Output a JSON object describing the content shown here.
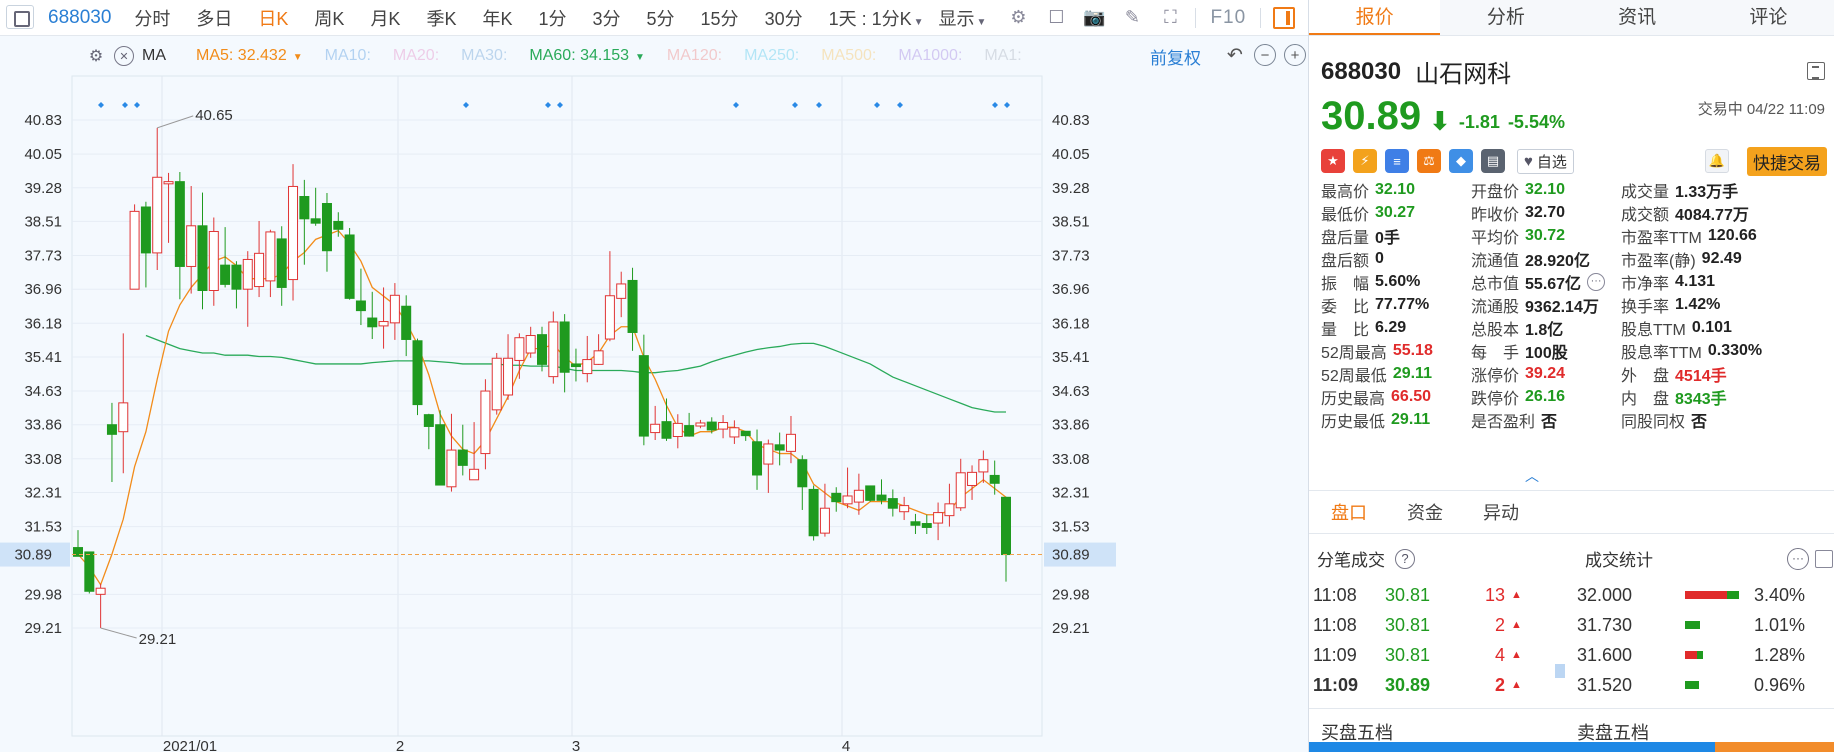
{
  "toolbar": {
    "symbol": "688030",
    "periods": [
      "分时",
      "多日",
      "日K",
      "周K",
      "月K",
      "季K",
      "年K",
      "1分",
      "3分",
      "5分",
      "15分",
      "30分"
    ],
    "active_period": "日K",
    "range_label": "1天 : 1分K",
    "display_label": "显示",
    "f10": "F10"
  },
  "chart": {
    "ma_selector": "MA",
    "ma": [
      {
        "label": "MA5: 32.432",
        "color": "#f28c1a",
        "active": true,
        "has_caret": true
      },
      {
        "label": "MA10:",
        "color": "#7fb4e8",
        "active": false
      },
      {
        "label": "MA20:",
        "color": "#e9a9d6",
        "active": false
      },
      {
        "label": "MA30:",
        "color": "#8fb8e0",
        "active": false
      },
      {
        "label": "MA60: 34.153",
        "color": "#2aaa5a",
        "active": true,
        "has_caret": true
      },
      {
        "label": "MA120:",
        "color": "#f0a3a3",
        "active": false
      },
      {
        "label": "MA250:",
        "color": "#7fd6f0",
        "active": false
      },
      {
        "label": "MA500:",
        "color": "#f6d28a",
        "active": false
      },
      {
        "label": "MA1000:",
        "color": "#b9a3ea",
        "active": false
      },
      {
        "label": "MA1:",
        "color": "#bfc6d0",
        "active": false
      }
    ],
    "adjust_label": "前复权",
    "price_ticks": [
      "40.83",
      "40.05",
      "39.28",
      "38.51",
      "37.73",
      "36.96",
      "36.18",
      "35.41",
      "34.63",
      "33.86",
      "33.08",
      "32.31",
      "31.53",
      "30.89",
      "29.98",
      "29.21"
    ],
    "current_price_label": "30.89",
    "x_labels": [
      "2021/01",
      "2",
      "3",
      "4"
    ],
    "max_annotation": "40.65",
    "min_annotation": "29.21"
  },
  "chart_data": {
    "type": "candlestick",
    "y_range": [
      28.6,
      41.3
    ],
    "current_price": 30.89,
    "candles": [
      {
        "o": 31.05,
        "c": 30.85,
        "h": 31.45,
        "l": 30.85
      },
      {
        "o": 30.95,
        "c": 30.05,
        "h": 30.95,
        "l": 30.0
      },
      {
        "o": 29.98,
        "c": 30.12,
        "h": 30.22,
        "l": 29.21
      },
      {
        "o": 33.86,
        "c": 33.64,
        "h": 34.36,
        "l": 32.55
      },
      {
        "o": 33.7,
        "c": 34.36,
        "h": 35.95,
        "l": 32.75
      },
      {
        "o": 36.96,
        "c": 38.74,
        "h": 38.9,
        "l": 36.96
      },
      {
        "o": 38.84,
        "c": 37.79,
        "h": 38.96,
        "l": 37.0
      },
      {
        "o": 37.79,
        "c": 39.52,
        "h": 40.65,
        "l": 37.4
      },
      {
        "o": 39.37,
        "c": 39.42,
        "h": 39.62,
        "l": 38.02
      },
      {
        "o": 39.42,
        "c": 37.48,
        "h": 39.64,
        "l": 36.73
      },
      {
        "o": 37.48,
        "c": 38.41,
        "h": 39.32,
        "l": 36.86
      },
      {
        "o": 38.41,
        "c": 36.93,
        "h": 39.17,
        "l": 36.5
      },
      {
        "o": 36.93,
        "c": 38.28,
        "h": 38.6,
        "l": 36.58
      },
      {
        "o": 37.51,
        "c": 37.07,
        "h": 38.38,
        "l": 37.0
      },
      {
        "o": 37.51,
        "c": 36.96,
        "h": 37.6,
        "l": 36.52
      },
      {
        "o": 36.96,
        "c": 37.64,
        "h": 37.83,
        "l": 36.1
      },
      {
        "o": 37.02,
        "c": 37.78,
        "h": 38.52,
        "l": 36.78
      },
      {
        "o": 37.15,
        "c": 38.27,
        "h": 38.32,
        "l": 36.78
      },
      {
        "o": 38.11,
        "c": 37.0,
        "h": 38.4,
        "l": 36.58
      },
      {
        "o": 37.18,
        "c": 39.31,
        "h": 39.82,
        "l": 36.7
      },
      {
        "o": 39.08,
        "c": 38.57,
        "h": 39.46,
        "l": 37.52
      },
      {
        "o": 38.57,
        "c": 38.47,
        "h": 39.28,
        "l": 38.41
      },
      {
        "o": 38.92,
        "c": 37.84,
        "h": 39.16,
        "l": 37.36
      },
      {
        "o": 38.51,
        "c": 38.33,
        "h": 38.72,
        "l": 38.16
      },
      {
        "o": 38.2,
        "c": 36.75,
        "h": 38.36,
        "l": 36.72
      },
      {
        "o": 36.69,
        "c": 36.47,
        "h": 37.43,
        "l": 36.14
      },
      {
        "o": 36.3,
        "c": 36.1,
        "h": 36.9,
        "l": 35.82
      },
      {
        "o": 36.12,
        "c": 36.22,
        "h": 37.0,
        "l": 35.6
      },
      {
        "o": 36.19,
        "c": 36.82,
        "h": 37.1,
        "l": 35.8
      },
      {
        "o": 36.57,
        "c": 35.81,
        "h": 36.82,
        "l": 35.43
      },
      {
        "o": 35.78,
        "c": 34.32,
        "h": 35.83,
        "l": 34.08
      },
      {
        "o": 34.09,
        "c": 33.82,
        "h": 34.11,
        "l": 33.3
      },
      {
        "o": 33.86,
        "c": 32.48,
        "h": 34.19,
        "l": 32.48
      },
      {
        "o": 32.44,
        "c": 33.28,
        "h": 34.11,
        "l": 32.33
      },
      {
        "o": 33.28,
        "c": 32.93,
        "h": 33.86,
        "l": 32.7
      },
      {
        "o": 32.6,
        "c": 32.84,
        "h": 33.92,
        "l": 32.6
      },
      {
        "o": 33.2,
        "c": 34.63,
        "h": 34.9,
        "l": 32.84
      },
      {
        "o": 34.2,
        "c": 35.38,
        "h": 35.5,
        "l": 34.09
      },
      {
        "o": 34.54,
        "c": 35.38,
        "h": 35.93,
        "l": 34.43
      },
      {
        "o": 35.33,
        "c": 35.85,
        "h": 35.95,
        "l": 34.91
      },
      {
        "o": 35.5,
        "c": 35.9,
        "h": 36.1,
        "l": 35.39
      },
      {
        "o": 35.92,
        "c": 35.24,
        "h": 36.1,
        "l": 35.08
      },
      {
        "o": 34.96,
        "c": 36.21,
        "h": 36.45,
        "l": 34.8
      },
      {
        "o": 36.21,
        "c": 35.06,
        "h": 36.39,
        "l": 34.6
      },
      {
        "o": 35.25,
        "c": 35.19,
        "h": 35.6,
        "l": 34.85
      },
      {
        "o": 35.03,
        "c": 35.35,
        "h": 35.89,
        "l": 34.83
      },
      {
        "o": 35.24,
        "c": 35.55,
        "h": 35.93,
        "l": 35.23
      },
      {
        "o": 35.82,
        "c": 36.81,
        "h": 37.83,
        "l": 35.77
      },
      {
        "o": 36.75,
        "c": 37.08,
        "h": 37.36,
        "l": 36.32
      },
      {
        "o": 37.16,
        "c": 35.97,
        "h": 37.45,
        "l": 35.55
      },
      {
        "o": 35.44,
        "c": 33.6,
        "h": 35.92,
        "l": 33.39
      },
      {
        "o": 33.68,
        "c": 33.87,
        "h": 34.29,
        "l": 33.51
      },
      {
        "o": 33.93,
        "c": 33.55,
        "h": 34.46,
        "l": 33.49
      },
      {
        "o": 33.59,
        "c": 33.89,
        "h": 34.1,
        "l": 33.32
      },
      {
        "o": 33.84,
        "c": 33.6,
        "h": 34.13,
        "l": 33.69
      },
      {
        "o": 33.83,
        "c": 33.9,
        "h": 33.97,
        "l": 33.78
      },
      {
        "o": 33.92,
        "c": 33.74,
        "h": 34.03,
        "l": 33.66
      },
      {
        "o": 33.76,
        "c": 33.91,
        "h": 34.08,
        "l": 33.55
      },
      {
        "o": 33.58,
        "c": 33.79,
        "h": 33.96,
        "l": 33.42
      },
      {
        "o": 33.71,
        "c": 33.61,
        "h": 33.7,
        "l": 33.49
      },
      {
        "o": 33.47,
        "c": 32.71,
        "h": 33.75,
        "l": 32.37
      },
      {
        "o": 32.96,
        "c": 33.42,
        "h": 33.52,
        "l": 32.3
      },
      {
        "o": 33.4,
        "c": 33.28,
        "h": 33.68,
        "l": 32.93
      },
      {
        "o": 33.25,
        "c": 33.64,
        "h": 34.06,
        "l": 32.98
      },
      {
        "o": 33.06,
        "c": 32.44,
        "h": 33.16,
        "l": 31.91
      },
      {
        "o": 32.38,
        "c": 31.32,
        "h": 32.47,
        "l": 31.21
      },
      {
        "o": 31.38,
        "c": 31.95,
        "h": 32.51,
        "l": 31.3
      },
      {
        "o": 32.29,
        "c": 32.1,
        "h": 32.43,
        "l": 31.87
      },
      {
        "o": 32.05,
        "c": 32.23,
        "h": 32.88,
        "l": 31.95
      },
      {
        "o": 32.09,
        "c": 32.36,
        "h": 32.74,
        "l": 31.8
      },
      {
        "o": 32.46,
        "c": 32.13,
        "h": 32.47,
        "l": 32.1
      },
      {
        "o": 32.25,
        "c": 32.13,
        "h": 32.61,
        "l": 32.04
      },
      {
        "o": 32.17,
        "c": 31.95,
        "h": 32.38,
        "l": 31.76
      },
      {
        "o": 31.87,
        "c": 32.01,
        "h": 32.21,
        "l": 31.68
      },
      {
        "o": 31.64,
        "c": 31.56,
        "h": 31.82,
        "l": 31.36
      },
      {
        "o": 31.6,
        "c": 31.51,
        "h": 31.8,
        "l": 31.36
      },
      {
        "o": 31.61,
        "c": 31.85,
        "h": 32.08,
        "l": 31.22
      },
      {
        "o": 31.78,
        "c": 32.05,
        "h": 32.51,
        "l": 31.53
      },
      {
        "o": 31.96,
        "c": 32.76,
        "h": 33.08,
        "l": 31.89
      },
      {
        "o": 32.47,
        "c": 32.77,
        "h": 32.93,
        "l": 32.14
      },
      {
        "o": 32.78,
        "c": 33.06,
        "h": 33.27,
        "l": 32.53
      },
      {
        "o": 32.7,
        "c": 32.52,
        "h": 33.04,
        "l": 32.26
      },
      {
        "o": 32.2,
        "c": 30.89,
        "h": 32.21,
        "l": 30.27
      }
    ],
    "ma5": [
      30.9,
      30.6,
      30.2,
      30.9,
      31.7,
      32.9,
      33.7,
      34.9,
      36.0,
      36.6,
      37.0,
      37.3,
      37.6,
      37.7,
      37.5,
      37.2,
      37.2,
      37.2,
      37.3,
      37.6,
      37.8,
      38.1,
      38.2,
      38.3,
      38.0,
      37.6,
      37.0,
      36.8,
      36.6,
      36.2,
      35.7,
      35.0,
      34.1,
      33.6,
      33.3,
      33.2,
      33.5,
      34.0,
      34.5,
      35.1,
      35.6,
      35.6,
      35.7,
      35.4,
      35.2,
      35.3,
      35.5,
      35.9,
      36.1,
      36.1,
      35.4,
      34.9,
      34.3,
      33.8,
      33.6,
      33.7,
      33.7,
      33.8,
      33.8,
      33.7,
      33.4,
      33.3,
      33.2,
      33.2,
      33.0,
      32.5,
      32.3,
      32.1,
      32.0,
      31.9,
      32.1,
      32.1,
      32.1,
      32.0,
      31.9,
      31.8,
      31.8,
      31.9,
      32.2,
      32.4,
      32.6,
      32.4,
      32.2
    ],
    "ma60": [
      35.9,
      35.8,
      35.7,
      35.6,
      35.55,
      35.5,
      35.5,
      35.45,
      35.45,
      35.45,
      35.42,
      35.42,
      35.4,
      35.35,
      35.3,
      35.25,
      35.25,
      35.25,
      35.25,
      35.25,
      35.28,
      35.3,
      35.32,
      35.32,
      35.32,
      35.32,
      35.3,
      35.28,
      35.25,
      35.25,
      35.25,
      35.25,
      35.22,
      35.22,
      35.2,
      35.2,
      35.2,
      35.15,
      35.1,
      35.1,
      35.1,
      35.1,
      35.1,
      35.08,
      35.05,
      35.05,
      35.08,
      35.1,
      35.15,
      35.2,
      35.3,
      35.38,
      35.45,
      35.52,
      35.58,
      35.62,
      35.65,
      35.7,
      35.72,
      35.72,
      35.65,
      35.55,
      35.45,
      35.35,
      35.25,
      35.1,
      34.95,
      34.85,
      34.75,
      34.65,
      34.55,
      34.45,
      34.35,
      34.25,
      34.2,
      34.15,
      34.15
    ]
  },
  "right": {
    "tabs": [
      "报价",
      "分析",
      "资讯",
      "评论"
    ],
    "active_tab": "报价",
    "code": "688030",
    "name": "山石网科",
    "price": "30.89",
    "change": "-1.81",
    "change_pct": "-5.54%",
    "status": "交易中 04/22 11:09",
    "watch_label": "自选",
    "trade_label": "快捷交易",
    "stats": [
      [
        {
          "k": "最高价",
          "v": "32.10",
          "c": "dn"
        },
        {
          "k": "开盘价",
          "v": "32.10",
          "c": "dn"
        },
        {
          "k": "成交量",
          "v": "1.33万手",
          "c": ""
        }
      ],
      [
        {
          "k": "最低价",
          "v": "30.27",
          "c": "dn"
        },
        {
          "k": "昨收价",
          "v": "32.70",
          "c": ""
        },
        {
          "k": "成交额",
          "v": "4084.77万",
          "c": ""
        }
      ],
      [
        {
          "k": "盘后量",
          "v": "0手",
          "c": ""
        },
        {
          "k": "平均价",
          "v": "30.72",
          "c": "dn"
        },
        {
          "k": "市盈率TTM",
          "v": "120.66",
          "c": ""
        }
      ],
      [
        {
          "k": "盘后额",
          "v": "0",
          "c": ""
        },
        {
          "k": "流通值",
          "v": "28.920亿",
          "c": ""
        },
        {
          "k": "市盈率(静)",
          "v": "92.49",
          "c": ""
        }
      ],
      [
        {
          "k": "振　幅",
          "v": "5.60%",
          "c": ""
        },
        {
          "k": "总市值",
          "v": "55.67亿",
          "c": "",
          "more": true
        },
        {
          "k": "市净率",
          "v": "4.131",
          "c": ""
        }
      ],
      [
        {
          "k": "委　比",
          "v": "77.77%",
          "c": ""
        },
        {
          "k": "流通股",
          "v": "9362.14万",
          "c": ""
        },
        {
          "k": "换手率",
          "v": "1.42%",
          "c": ""
        }
      ],
      [
        {
          "k": "量　比",
          "v": "6.29",
          "c": ""
        },
        {
          "k": "总股本",
          "v": "1.8亿",
          "c": ""
        },
        {
          "k": "股息TTM",
          "v": "0.101",
          "c": ""
        }
      ],
      [
        {
          "k": "52周最高",
          "v": "55.18",
          "c": "up"
        },
        {
          "k": "每　手",
          "v": "100股",
          "c": ""
        },
        {
          "k": "股息率TTM",
          "v": "0.330%",
          "c": ""
        }
      ],
      [
        {
          "k": "52周最低",
          "v": "29.11",
          "c": "dn"
        },
        {
          "k": "涨停价",
          "v": "39.24",
          "c": "up"
        },
        {
          "k": "外　盘",
          "v": "4514手",
          "c": "up"
        }
      ],
      [
        {
          "k": "历史最高",
          "v": "66.50",
          "c": "up"
        },
        {
          "k": "跌停价",
          "v": "26.16",
          "c": "dn"
        },
        {
          "k": "内　盘",
          "v": "8343手",
          "c": "dn"
        }
      ],
      [
        {
          "k": "历史最低",
          "v": "29.11",
          "c": "dn"
        },
        {
          "k": "是否盈利",
          "v": "否",
          "c": ""
        },
        {
          "k": "同股同权",
          "v": "否",
          "c": ""
        }
      ]
    ],
    "sub_tabs": [
      "盘口",
      "资金",
      "异动"
    ],
    "active_sub_tab": "盘口",
    "trades_title": "分笔成交",
    "volstats_title": "成交统计",
    "trades": [
      {
        "time": "11:08",
        "price": "30.81",
        "vol": "13"
      },
      {
        "time": "11:08",
        "price": "30.81",
        "vol": "2"
      },
      {
        "time": "11:09",
        "price": "30.81",
        "vol": "4"
      },
      {
        "time": "11:09",
        "price": "30.89",
        "vol": "2"
      }
    ],
    "volstats": [
      {
        "price": "32.000",
        "red": 0.78,
        "green": 0.22,
        "pct": "3.40%"
      },
      {
        "price": "31.730",
        "red": 0.0,
        "green": 0.28,
        "pct": "1.01%"
      },
      {
        "price": "31.600",
        "red": 0.22,
        "green": 0.12,
        "pct": "1.28%"
      },
      {
        "price": "31.520",
        "red": 0.0,
        "green": 0.26,
        "pct": "0.96%"
      }
    ],
    "book_buy": "买盘五档",
    "book_sell": "卖盘五档"
  }
}
